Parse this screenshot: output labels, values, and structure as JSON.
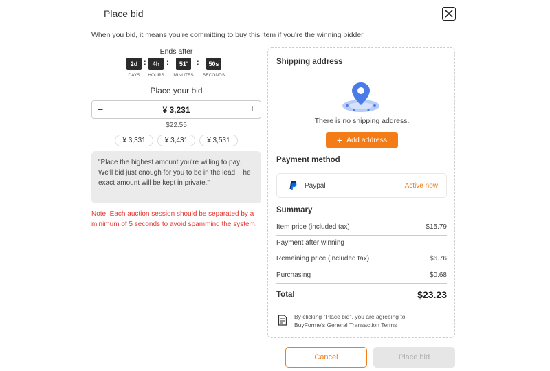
{
  "dialog": {
    "title": "Place bid",
    "intro": "When you bid, it means you're committing to buy this item if you're the winning bidder."
  },
  "countdown": {
    "heading": "Ends after",
    "units": [
      {
        "value": "2d",
        "label": "DAYS"
      },
      {
        "value": "4h",
        "label": "HOURS"
      },
      {
        "value": "51'",
        "label": "MINUTES"
      },
      {
        "value": "50s",
        "label": "SECONDS"
      }
    ],
    "separator": ":"
  },
  "bid": {
    "heading": "Place your bid",
    "minus": "−",
    "plus": "+",
    "value": "¥ 3,231",
    "converted": "$22.55",
    "suggestions": [
      "¥ 3,331",
      "¥ 3,431",
      "¥ 3,531"
    ],
    "note": "\"Place the highest amount you're willing to pay. We'll bid just enough for you to be in the lead. The exact amount will be kept in private.\"",
    "warning": "Note: Each auction session should be separated by a minimum of 5 seconds to avoid spammind the system."
  },
  "shipping": {
    "heading": "Shipping address",
    "empty_text": "There is no shipping address.",
    "add_label": "Add address",
    "add_icon": "+"
  },
  "payment": {
    "heading": "Payment method",
    "method": "Paypal",
    "status": "Active now"
  },
  "summary": {
    "heading": "Summary",
    "item_price_label": "Item price (included tax)",
    "item_price": "$15.79",
    "after_winning_label": "Payment after winning",
    "remaining_label": "Remaining price (included tax)",
    "remaining": "$6.76",
    "purchasing_label": "Purchasing",
    "purchasing": "$0.68",
    "total_label": "Total",
    "total": "$23.23"
  },
  "terms": {
    "line1": "By clicking \"Place bid\", you are agreeing to",
    "link": "BuyForme's General Transaction Terms"
  },
  "footer": {
    "cancel_label": "Cancel",
    "place_label": "Place bid"
  },
  "colors": {
    "accent": "#f47c16",
    "warning": "#e53935",
    "timer_bg": "#2b2b2b",
    "pin_blue": "#4a7be8"
  }
}
